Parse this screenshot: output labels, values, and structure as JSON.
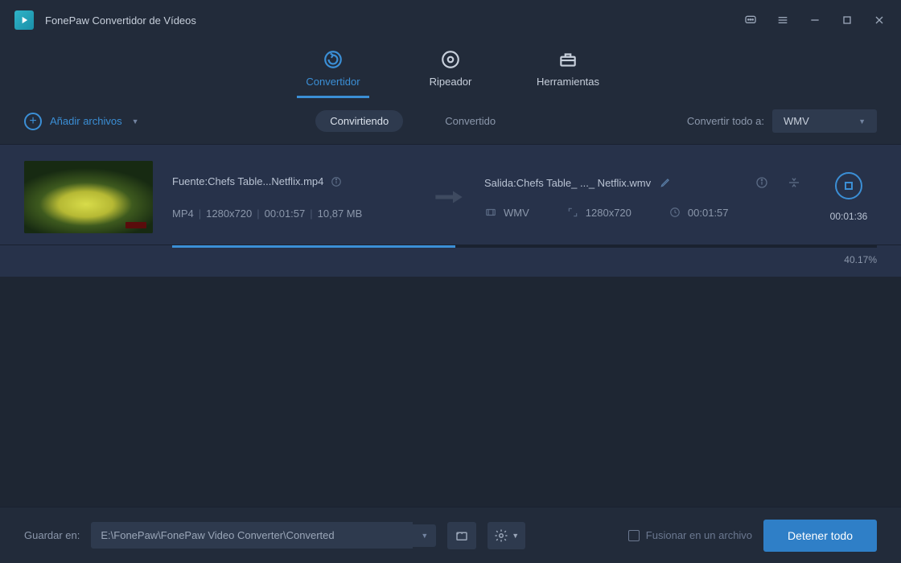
{
  "app": {
    "title": "FonePaw Convertidor de Vídeos"
  },
  "tabs": {
    "converter": "Convertidor",
    "ripper": "Ripeador",
    "tools": "Herramientas"
  },
  "actionbar": {
    "add_files": "Añadir archivos",
    "seg_converting": "Convirtiendo",
    "seg_converted": "Convertido",
    "convert_all_to": "Convertir todo a:",
    "format": "WMV"
  },
  "item": {
    "source_label": "Fuente:Chefs Table...Netflix.mp4",
    "src_format": "MP4",
    "src_res": "1280x720",
    "src_dur": "00:01:57",
    "src_size": "10,87 MB",
    "output_label": "Salida:Chefs Table_ ..._ Netflix.wmv",
    "out_format": "WMV",
    "out_res": "1280x720",
    "out_dur": "00:01:57",
    "progress_pct": "40.17%",
    "eta": "00:01:36"
  },
  "bottom": {
    "save_in": "Guardar en:",
    "path": "E:\\FonePaw\\FonePaw Video Converter\\Converted",
    "merge": "Fusionar en un archivo",
    "stop_all": "Detener todo"
  }
}
